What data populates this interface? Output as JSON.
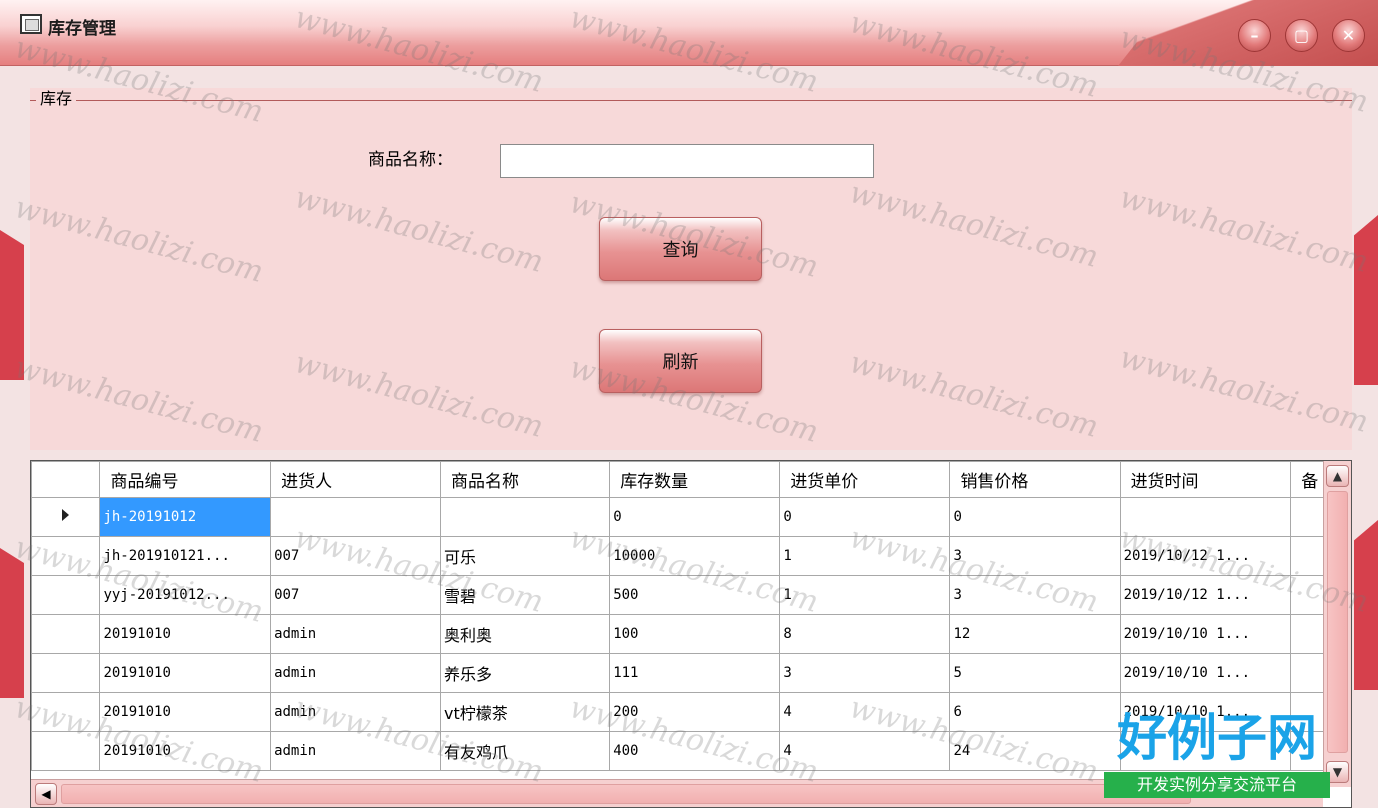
{
  "window": {
    "title": "库存管理"
  },
  "groupbox": {
    "legend": "库存"
  },
  "search": {
    "label": "商品名称：",
    "value": "",
    "placeholder": ""
  },
  "buttons": {
    "query": "查询",
    "refresh": "刷新"
  },
  "table": {
    "columns": [
      "商品编号",
      "进货人",
      "商品名称",
      "库存数量",
      "进货单价",
      "销售价格",
      "进货时间",
      "备"
    ],
    "rows": [
      [
        "jh-20191012",
        "",
        "",
        "0",
        "0",
        "0",
        ""
      ],
      [
        "jh-201910121...",
        "007",
        "可乐",
        "10000",
        "1",
        "3",
        "2019/10/12 1..."
      ],
      [
        "yyj-20191012...",
        "007",
        "雪碧",
        "500",
        "1",
        "3",
        "2019/10/12 1..."
      ],
      [
        "20191010",
        "admin",
        "奥利奥",
        "100",
        "8",
        "12",
        "2019/10/10 1..."
      ],
      [
        "20191010",
        "admin",
        "养乐多",
        "111",
        "3",
        "5",
        "2019/10/10 1..."
      ],
      [
        "20191010",
        "admin",
        "vt柠檬茶",
        "200",
        "4",
        "6",
        "2019/10/10 1..."
      ],
      [
        "20191010",
        "admin",
        "有友鸡爪",
        "400",
        "4",
        "24",
        ""
      ]
    ]
  },
  "watermark": {
    "text": "www.haolizi.com",
    "badge_title": "好例子网",
    "badge_subtitle": "开发实例分享交流平台"
  },
  "colors": {
    "titlebar": "#e57f7f",
    "panel": "#f7d9d9",
    "selected_cell": "#3399ff",
    "stripe": "#d6404c"
  }
}
